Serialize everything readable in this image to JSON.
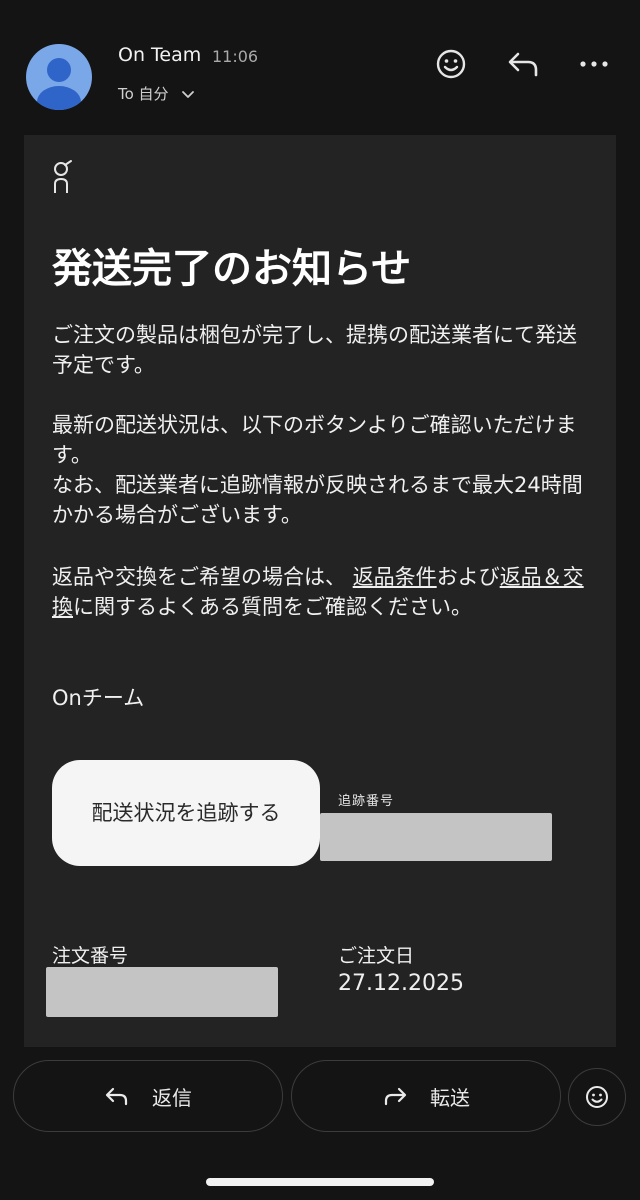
{
  "header": {
    "sender_name": "On Team",
    "time": "11:06",
    "recipient": "To 自分",
    "icons": [
      "emoji-icon",
      "reply-icon",
      "more-icon"
    ]
  },
  "email": {
    "logo": "on-logo",
    "title": "発送完了のお知らせ",
    "paragraph1": "ご注文の製品は梱包が完了し、提携の配送業者にて発送予定です。",
    "paragraph2_line1": "最新の配送状況は、以下のボタンよりご確認いただけます。",
    "paragraph2_line2": "なお、配送業者に追跡情報が反映されるまで最大24時間かかる場合がございます。",
    "paragraph3_pre": "返品や交換をご希望の場合は、 ",
    "paragraph3_link1": "返品条件",
    "paragraph3_mid": "および",
    "paragraph3_link2": "返品＆交換",
    "paragraph3_post": "に関するよくある質問をご確認ください。",
    "signature": "Onチーム",
    "track_button": "配送状況を追跡する",
    "tracking_label": "追跡番号",
    "order_number_label": "注文番号",
    "order_date_label": "ご注文日",
    "order_date": "27.12.2025"
  },
  "actions": {
    "reply_label": "返信",
    "forward_label": "転送"
  },
  "colors": {
    "background": "#141414",
    "card": "#232323",
    "avatar": "#7aa7e8",
    "redacted": "#c4c4c4"
  }
}
